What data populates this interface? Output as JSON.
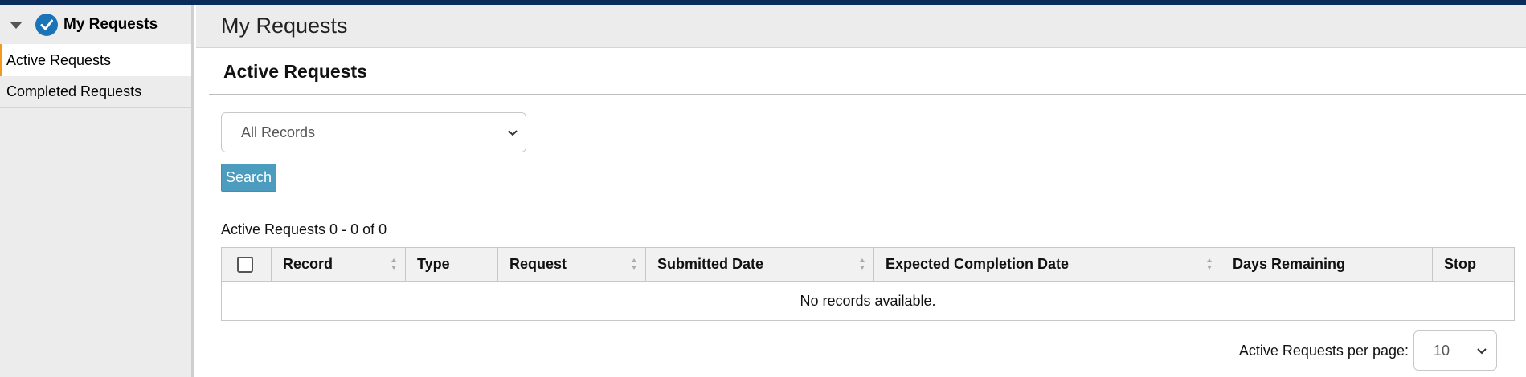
{
  "sidebar": {
    "title": "My Requests",
    "items": [
      {
        "label": "Active Requests",
        "active": true
      },
      {
        "label": "Completed Requests",
        "active": false
      }
    ]
  },
  "header": {
    "title": "My Requests"
  },
  "section": {
    "title": "Active Requests"
  },
  "filter": {
    "selected": "All Records"
  },
  "search": {
    "label": "Search"
  },
  "count_text": "Active Requests 0 - 0 of 0",
  "table": {
    "columns": [
      "Record",
      "Type",
      "Request",
      "Submitted Date",
      "Expected Completion Date",
      "Days Remaining",
      "Stop"
    ],
    "empty_message": "No records available."
  },
  "pager": {
    "label": "Active Requests per page:",
    "value": "10"
  },
  "colors": {
    "accent": "#f29a1f",
    "button": "#4b9cbf",
    "topbar": "#0c2a5a",
    "check": "#1b74b8"
  }
}
